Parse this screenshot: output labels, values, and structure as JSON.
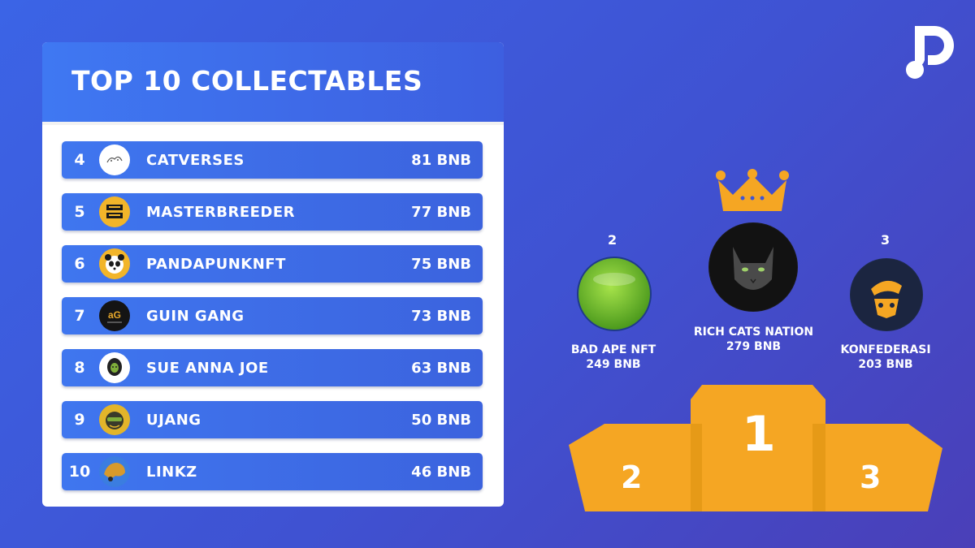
{
  "title": "TOP 10 COLLECTABLES",
  "list": [
    {
      "rank": "4",
      "name": "CATVERSES",
      "price": "81 BNB",
      "avatar_text": "",
      "avatar_bg": "#ffffff",
      "avatar_fg": "#333333"
    },
    {
      "rank": "5",
      "name": "MASTERBREEDER",
      "price": "77 BNB",
      "avatar_text": "ROACH PUNK",
      "avatar_bg": "#f2b52a",
      "avatar_fg": "#1a1a1a"
    },
    {
      "rank": "6",
      "name": "PANDAPUNKNFT",
      "price": "75 BNB",
      "avatar_text": "",
      "avatar_bg": "#f2b52a",
      "avatar_fg": "#1a1a1a"
    },
    {
      "rank": "7",
      "name": "GUIN GANG",
      "price": "73 BNB",
      "avatar_text": "GUIN GANG",
      "avatar_bg": "#141414",
      "avatar_fg": "#e8a82a"
    },
    {
      "rank": "8",
      "name": "SUE ANNA JOE",
      "price": "63 BNB",
      "avatar_text": "",
      "avatar_bg": "#ffffff",
      "avatar_fg": "#222222"
    },
    {
      "rank": "9",
      "name": "UJANG",
      "price": "50 BNB",
      "avatar_text": "",
      "avatar_bg": "#e3b52a",
      "avatar_fg": "#2b2b2b"
    },
    {
      "rank": "10",
      "name": "LINKZ",
      "price": "46 BNB",
      "avatar_text": "",
      "avatar_bg": "#3b7de0",
      "avatar_fg": "#d89a2b"
    }
  ],
  "podium": {
    "first": {
      "rank": "1",
      "name": "RICH CATS NATION",
      "price": "279 BNB"
    },
    "second": {
      "rank": "2",
      "name": "BAD APE NFT",
      "price": "249 BNB"
    },
    "third": {
      "rank": "3",
      "name": "KONFEDERASI",
      "price": "203 BNB"
    }
  },
  "colors": {
    "gold": "#f5a623",
    "row_blue": "#3f6fea",
    "background": "#3f55d4"
  },
  "icons": [
    "brand-logo-icon",
    "crown-icon"
  ]
}
